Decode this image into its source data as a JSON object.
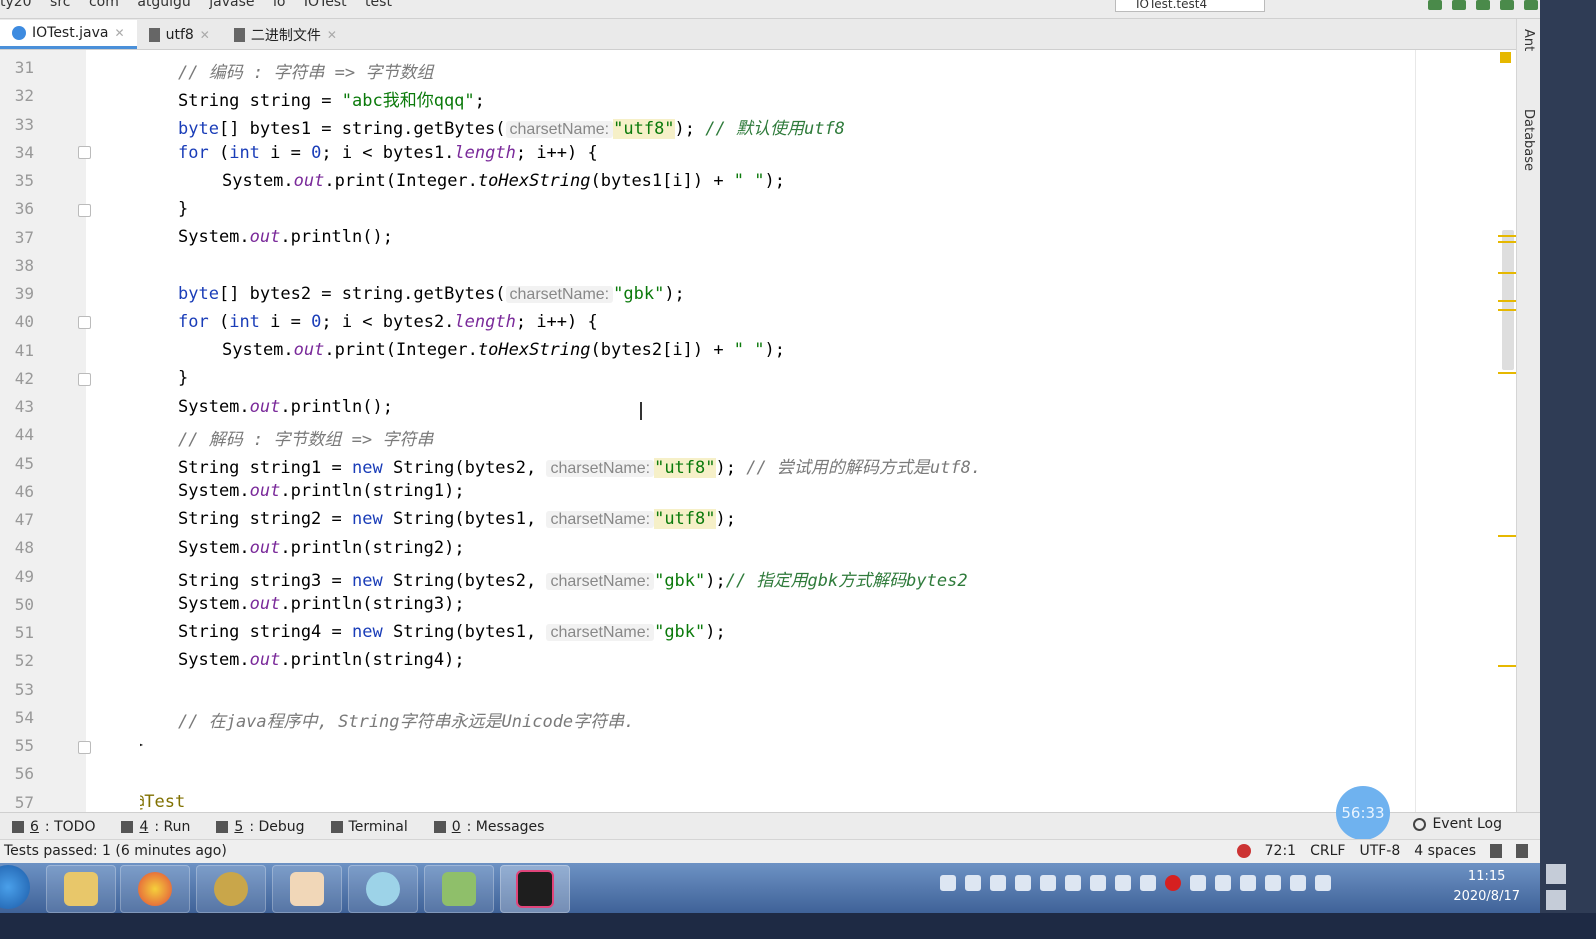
{
  "breadcrumb": [
    "ty20",
    "src",
    "com",
    "atguigu",
    "javase",
    "io",
    "IOTest",
    "test"
  ],
  "run_config": "IOTest.test4",
  "tabs": [
    {
      "label": "IOTest.java",
      "active": true
    },
    {
      "label": "utf8",
      "active": false
    },
    {
      "label": "二进制文件",
      "active": false
    }
  ],
  "gutter": {
    "lines": [
      "31",
      "32",
      "33",
      "34",
      "35",
      "36",
      "37",
      "38",
      "39",
      "40",
      "41",
      "42",
      "43",
      "44",
      "45",
      "46",
      "47",
      "48",
      "49",
      "50",
      "51",
      "52",
      "53",
      "54",
      "55",
      "56",
      "57"
    ]
  },
  "code": {
    "l31": {
      "comment": "// 编码 : 字符串 => 字节数组"
    },
    "l32": {
      "text": "String string = ",
      "str": "\"abc我和你qqq\"",
      "end": ";"
    },
    "l33": {
      "kw": "byte",
      "a": "[] bytes1 = string.getBytes(",
      "hint": "charsetName:",
      "str": "\"utf8\"",
      "b": "); ",
      "comment": "// 默认使用utf8"
    },
    "l34": {
      "kw1": "for",
      "a": " (",
      "kw2": "int",
      "b": " i = ",
      "num": "0",
      "c": "; i < bytes1.",
      "fld": "length",
      "d": "; i++) {"
    },
    "l35": {
      "a": "System.",
      "fld": "out",
      "b": ".print(Integer.",
      "meth": "toHexString",
      "c": "(bytes1[i]) + ",
      "str": "\" \"",
      "d": ");"
    },
    "l36": {
      "text": "}"
    },
    "l37": {
      "a": "System.",
      "fld": "out",
      "b": ".println();"
    },
    "l39": {
      "kw": "byte",
      "a": "[] bytes2 = string.getBytes(",
      "hint": "charsetName:",
      "str": "\"gbk\"",
      "b": ");"
    },
    "l40": {
      "kw1": "for",
      "a": " (",
      "kw2": "int",
      "b": " i = ",
      "num": "0",
      "c": "; i < bytes2.",
      "fld": "length",
      "d": "; i++) {"
    },
    "l41": {
      "a": "System.",
      "fld": "out",
      "b": ".print(Integer.",
      "meth": "toHexString",
      "c": "(bytes2[i]) + ",
      "str": "\" \"",
      "d": ");"
    },
    "l42": {
      "text": "}"
    },
    "l43": {
      "a": "System.",
      "fld": "out",
      "b": ".println();"
    },
    "l44": {
      "comment": "// 解码 : 字节数组 => 字符串"
    },
    "l45": {
      "a": "String string1 = ",
      "kw": "new",
      "b": " String(bytes2, ",
      "hint": "charsetName:",
      "str": "\"utf8\"",
      "c": "); ",
      "comment": "// 尝试用的解码方式是utf8."
    },
    "l46": {
      "a": "System.",
      "fld": "out",
      "b": ".println(string1);"
    },
    "l47": {
      "a": "String string2 = ",
      "kw": "new",
      "b": " String(bytes1, ",
      "hint": "charsetName:",
      "str": "\"utf8\"",
      "c": ");"
    },
    "l48": {
      "a": "System.",
      "fld": "out",
      "b": ".println(string2);"
    },
    "l49": {
      "a": "String string3 = ",
      "kw": "new",
      "b": " String(bytes2, ",
      "hint": "charsetName:",
      "str": "\"gbk\"",
      "c": ");",
      "comment": "// 指定用gbk方式解码bytes2"
    },
    "l50": {
      "a": "System.",
      "fld": "out",
      "b": ".println(string3);"
    },
    "l51": {
      "a": "String string4 = ",
      "kw": "new",
      "b": " String(bytes1, ",
      "hint": "charsetName:",
      "str": "\"gbk\"",
      "c": ");"
    },
    "l52": {
      "a": "System.",
      "fld": "out",
      "b": ".println(string4);"
    },
    "l54": {
      "comment": "// 在java程序中, String字符串永远是Unicode字符串."
    },
    "l55": {
      "text": "}"
    },
    "l57": {
      "ann": "@Test"
    }
  },
  "sidebar": {
    "ant": "Ant",
    "database": "Database"
  },
  "toolwindows": [
    {
      "num": "6",
      "label": ": TODO"
    },
    {
      "num": "4",
      "label": ": Run"
    },
    {
      "num": "5",
      "label": ": Debug"
    },
    {
      "num": "",
      "label": "Terminal"
    },
    {
      "num": "0",
      "label": ": Messages"
    }
  ],
  "event_log": "Event Log",
  "timer_bubble": "56:33",
  "status": {
    "message": "Tests passed: 1 (6 minutes ago)",
    "position": "72:1",
    "line_sep": "CRLF",
    "encoding": "UTF-8",
    "indent": "4 spaces"
  },
  "clock": {
    "time": "11:15",
    "date": "2020/8/17"
  },
  "colors": {
    "keyword": "#1a3db8",
    "string": "#0b7a0b",
    "comment": "#7a7a7a",
    "accent": "#4a90d9"
  }
}
